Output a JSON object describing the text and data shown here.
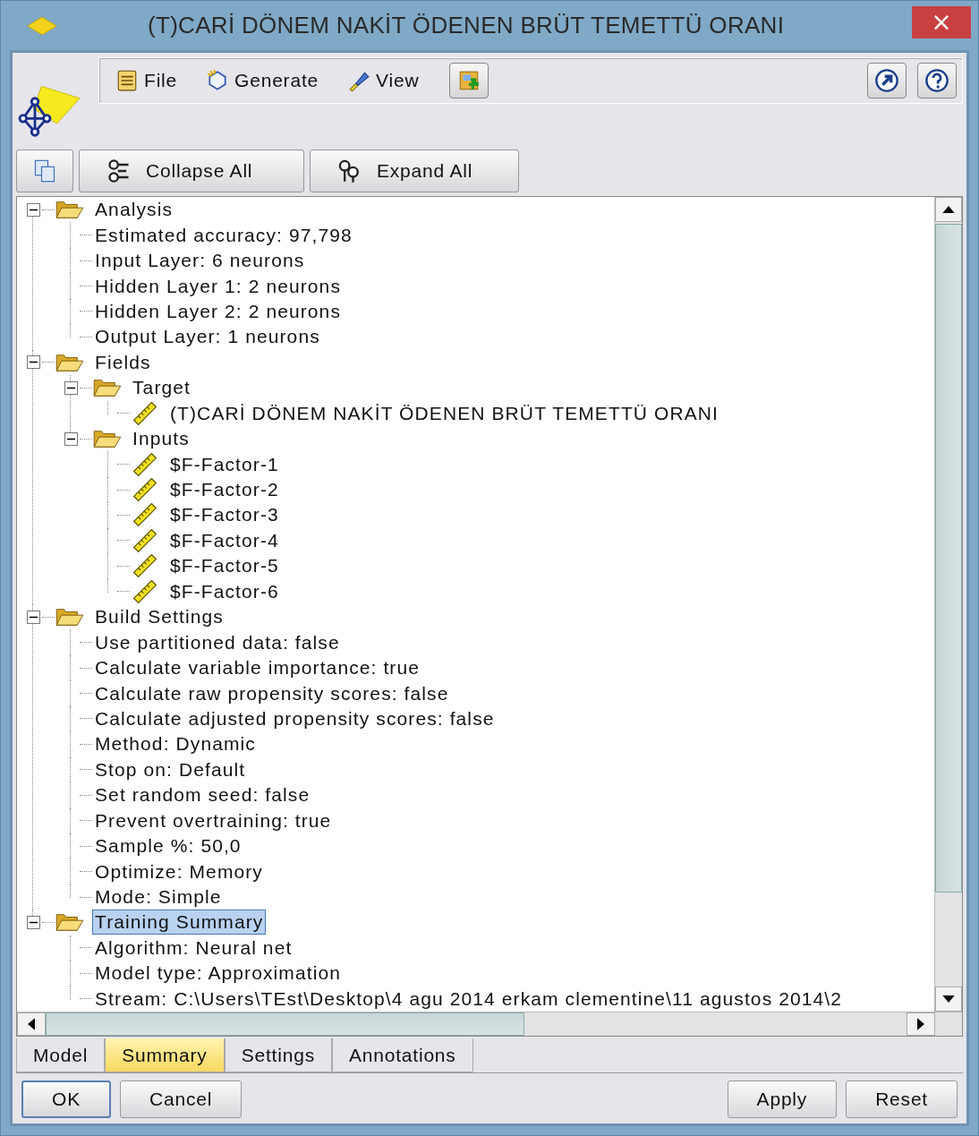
{
  "window": {
    "title": "(T)CARİ DÖNEM NAKİT ÖDENEN BRÜT TEMETTÜ ORANI",
    "close": "×"
  },
  "menu": [
    {
      "label": "File",
      "kind": "file"
    },
    {
      "label": "Generate",
      "kind": "generate"
    },
    {
      "label": "View",
      "kind": "view"
    }
  ],
  "toolbar": [
    {
      "label": "Collapse All",
      "kind": "collapse"
    },
    {
      "label": "Expand All",
      "kind": "expand"
    }
  ],
  "tree": [
    {
      "label": "Analysis",
      "kind": "folder",
      "expanded": true,
      "selected": false,
      "children": [
        {
          "label": "Estimated accuracy: 97,798",
          "kind": "text",
          "selected": false
        },
        {
          "label": "Input Layer: 6 neurons",
          "kind": "text",
          "selected": false
        },
        {
          "label": "Hidden Layer 1: 2 neurons",
          "kind": "text",
          "selected": false
        },
        {
          "label": "Hidden Layer 2: 2 neurons",
          "kind": "text",
          "selected": false
        },
        {
          "label": "Output Layer: 1 neurons",
          "kind": "text",
          "selected": false
        }
      ]
    },
    {
      "label": "Fields",
      "kind": "folder",
      "expanded": true,
      "selected": false,
      "children": [
        {
          "label": "Target",
          "kind": "folder",
          "expanded": true,
          "selected": false,
          "children": [
            {
              "label": "(T)CARİ DÖNEM NAKİT ÖDENEN BRÜT TEMETTÜ ORANI",
              "kind": "field",
              "selected": false
            }
          ]
        },
        {
          "label": "Inputs",
          "kind": "folder",
          "expanded": true,
          "selected": false,
          "children": [
            {
              "label": "$F-Factor-1",
              "kind": "field",
              "selected": false
            },
            {
              "label": "$F-Factor-2",
              "kind": "field",
              "selected": false
            },
            {
              "label": "$F-Factor-3",
              "kind": "field",
              "selected": false
            },
            {
              "label": "$F-Factor-4",
              "kind": "field",
              "selected": false
            },
            {
              "label": "$F-Factor-5",
              "kind": "field",
              "selected": false
            },
            {
              "label": "$F-Factor-6",
              "kind": "field",
              "selected": false
            }
          ]
        }
      ]
    },
    {
      "label": "Build Settings",
      "kind": "folder",
      "expanded": true,
      "selected": false,
      "children": [
        {
          "label": "Use partitioned data: false",
          "kind": "text",
          "selected": false
        },
        {
          "label": "Calculate variable importance: true",
          "kind": "text",
          "selected": false
        },
        {
          "label": "Calculate raw propensity scores: false",
          "kind": "text",
          "selected": false
        },
        {
          "label": "Calculate adjusted propensity scores: false",
          "kind": "text",
          "selected": false
        },
        {
          "label": "Method: Dynamic",
          "kind": "text",
          "selected": false
        },
        {
          "label": "Stop on: Default",
          "kind": "text",
          "selected": false
        },
        {
          "label": "Set random seed: false",
          "kind": "text",
          "selected": false
        },
        {
          "label": "Prevent overtraining: true",
          "kind": "text",
          "selected": false
        },
        {
          "label": "Sample %: 50,0",
          "kind": "text",
          "selected": false
        },
        {
          "label": "Optimize: Memory",
          "kind": "text",
          "selected": false
        },
        {
          "label": "Mode: Simple",
          "kind": "text",
          "selected": false
        }
      ]
    },
    {
      "label": "Training Summary",
      "kind": "folder",
      "expanded": true,
      "selected": true,
      "children": [
        {
          "label": "Algorithm: Neural net",
          "kind": "text",
          "selected": false
        },
        {
          "label": "Model type: Approximation",
          "kind": "text",
          "selected": false
        },
        {
          "label": "Stream: C:\\Users\\TEst\\Desktop\\4 agu 2014 erkam clementine\\11 agustos 2014\\2",
          "kind": "text",
          "selected": false
        }
      ]
    }
  ],
  "tabs": [
    {
      "label": "Model",
      "selected": false
    },
    {
      "label": "Summary",
      "selected": true
    },
    {
      "label": "Settings",
      "selected": false
    },
    {
      "label": "Annotations",
      "selected": false
    }
  ],
  "buttons": [
    {
      "label": "OK",
      "kind": "default"
    },
    {
      "label": "Cancel",
      "kind": "normal"
    },
    {
      "label": "Apply",
      "kind": "normal"
    },
    {
      "label": "Reset",
      "kind": "normal"
    }
  ]
}
